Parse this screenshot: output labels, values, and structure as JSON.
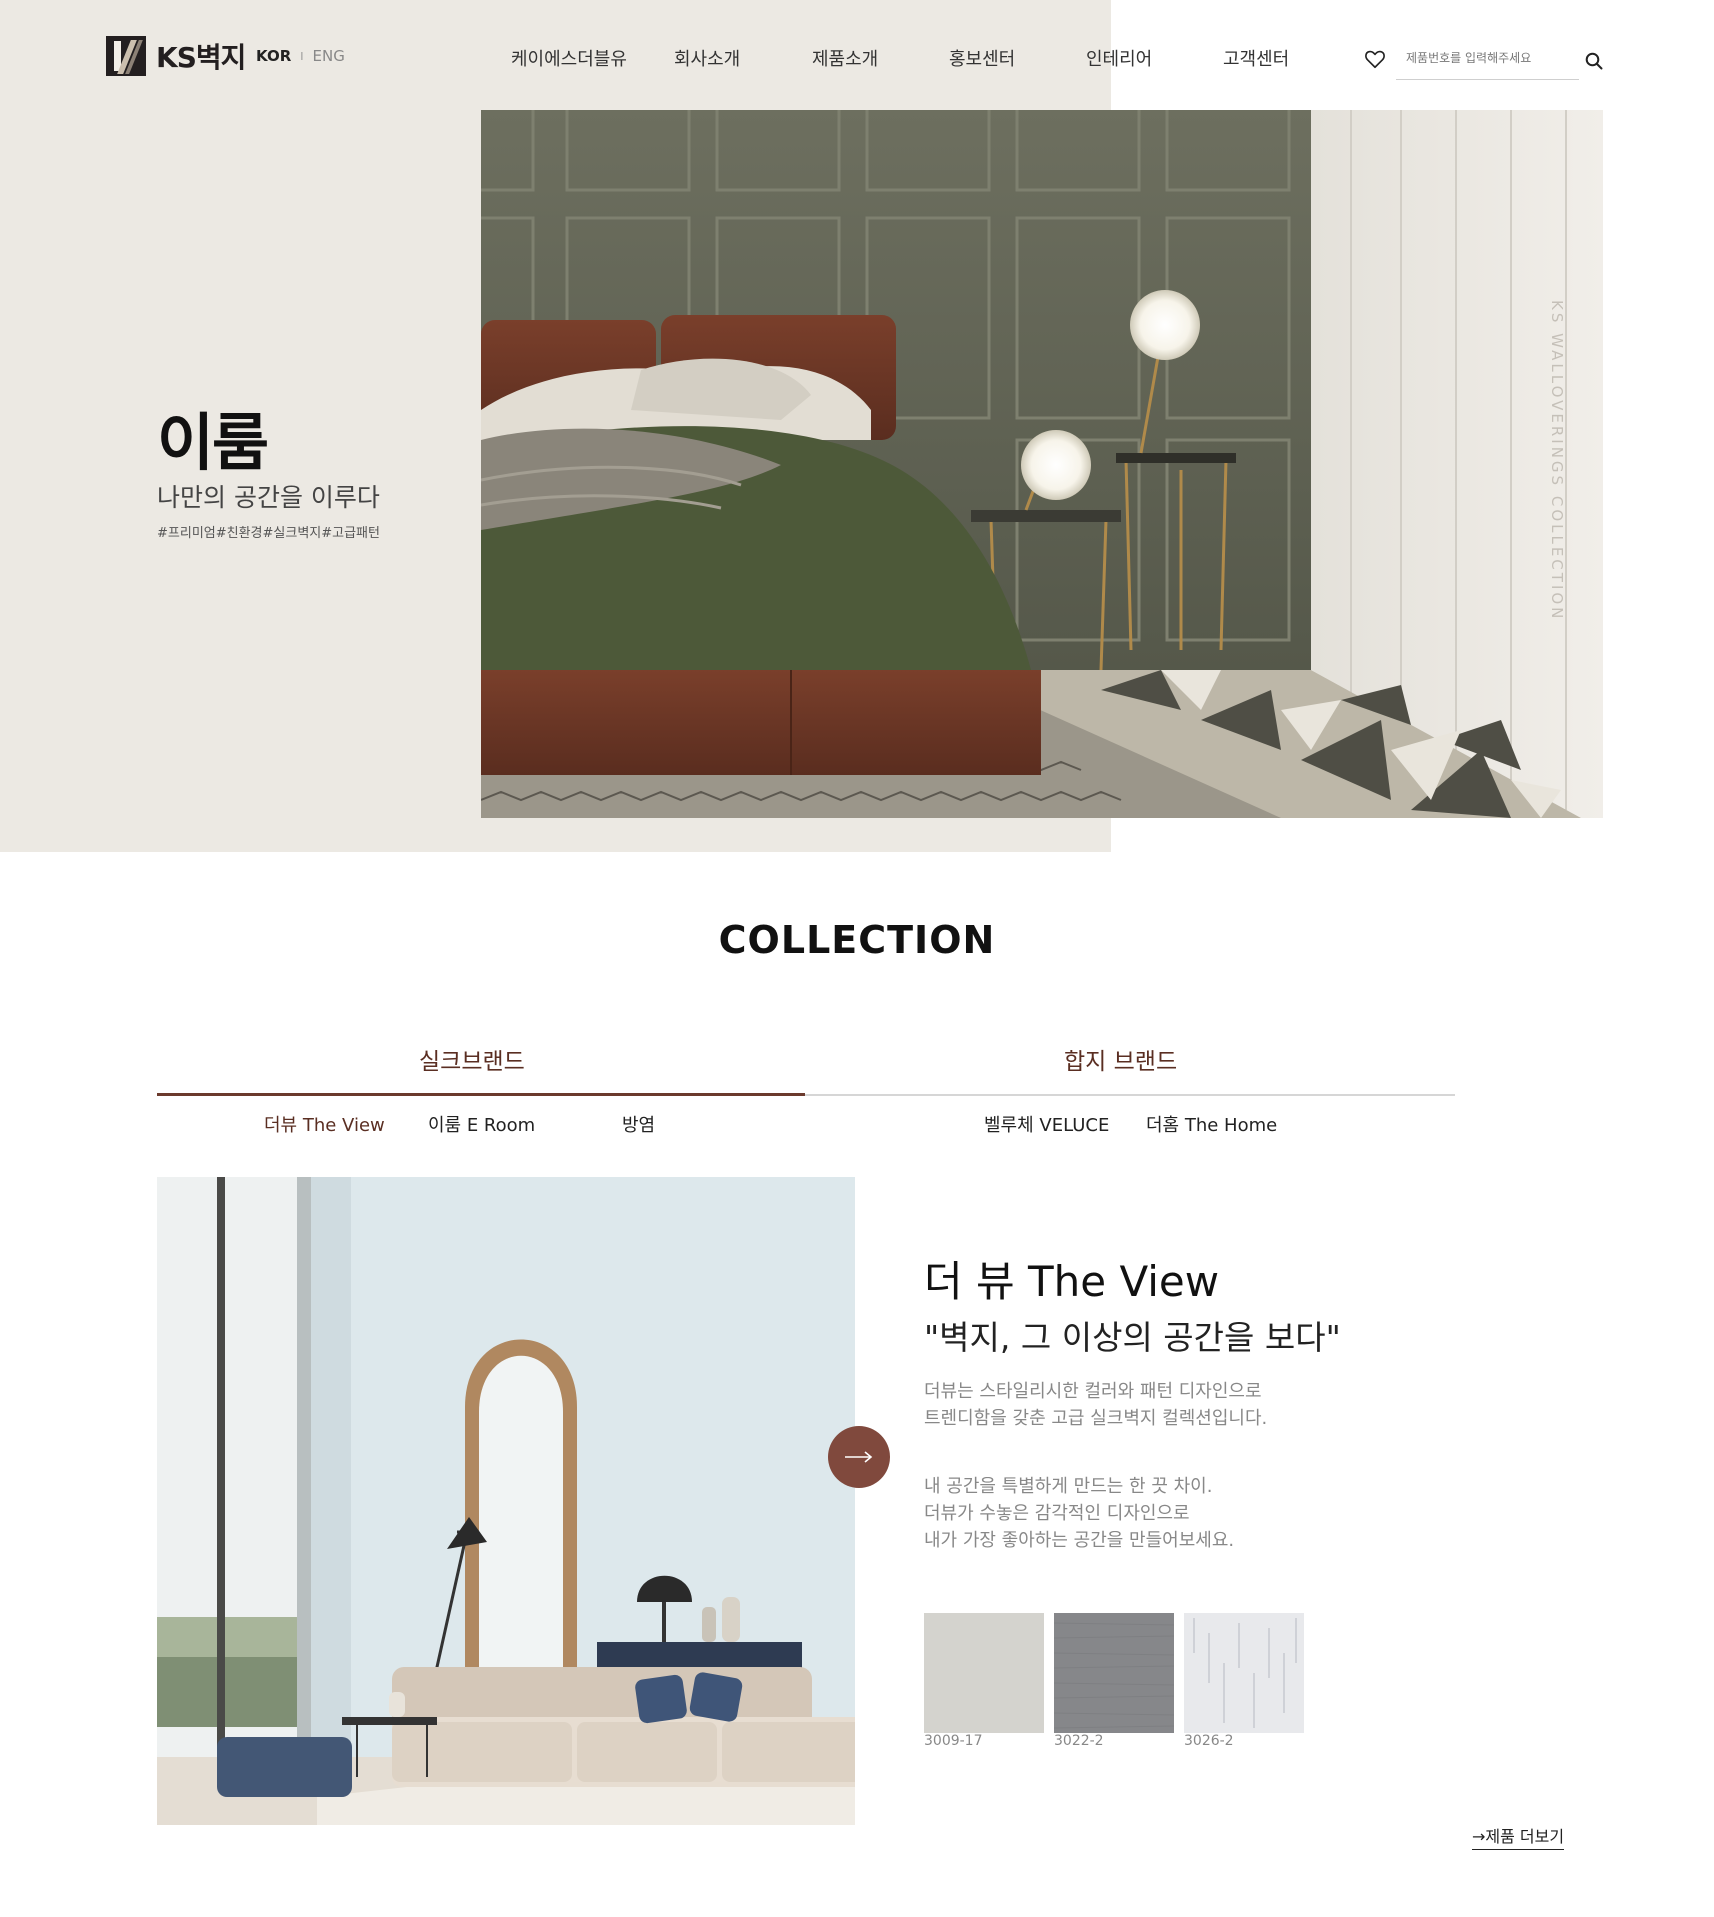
{
  "header": {
    "logo_text": "KS벽지",
    "lang_kor": "KOR",
    "lang_sep": "I",
    "lang_eng": "ENG",
    "nav": [
      "케이에스더블유",
      "회사소개",
      "제품소개",
      "홍보센터",
      "인테리어",
      "고객센터"
    ],
    "search_placeholder": "제품번호를 입력해주세요"
  },
  "hero": {
    "title": "이룸",
    "subtitle": "나만의 공간을 이루다",
    "tags": "#프리미엄#친환경#실크벽지#고급패턴",
    "vertical_text": "KS WALLOVERINGS COLLECTION"
  },
  "collection": {
    "title": "COLLECTION",
    "brand_tabs": [
      "실크브랜드",
      "합지 브랜드"
    ],
    "sub_tabs_silk": [
      "더뷰 The View",
      "이룸 E Room",
      "방염"
    ],
    "sub_tabs_hapji": [
      "벨루체 VELUCE",
      "더홈 The Home"
    ],
    "product": {
      "title": "더 뷰 The View",
      "quote": "\"벽지, 그 이상의 공간을 보다\"",
      "desc1_line1": "더뷰는 스타일리시한 컬러와 패턴 디자인으로",
      "desc1_line2": "트렌디함을 갖춘 고급 실크벽지 컬렉션입니다.",
      "desc2_line1": "내 공간을 특별하게 만드는 한 끗 차이.",
      "desc2_line2": "더뷰가 수놓은 감각적인 디자인으로",
      "desc2_line3": "내가 가장 좋아하는 공간을 만들어보세요.",
      "swatches": [
        {
          "code": "3009-17",
          "color": "#d4d3ce"
        },
        {
          "code": "3022-2",
          "color": "#86878a"
        },
        {
          "code": "3026-2",
          "color": "#e8e9ec"
        }
      ]
    },
    "more_link": "→제품 더보기"
  },
  "colors": {
    "hero_bg": "#ece9e3",
    "accent": "#80493d",
    "brand_text": "#5a2e22"
  }
}
